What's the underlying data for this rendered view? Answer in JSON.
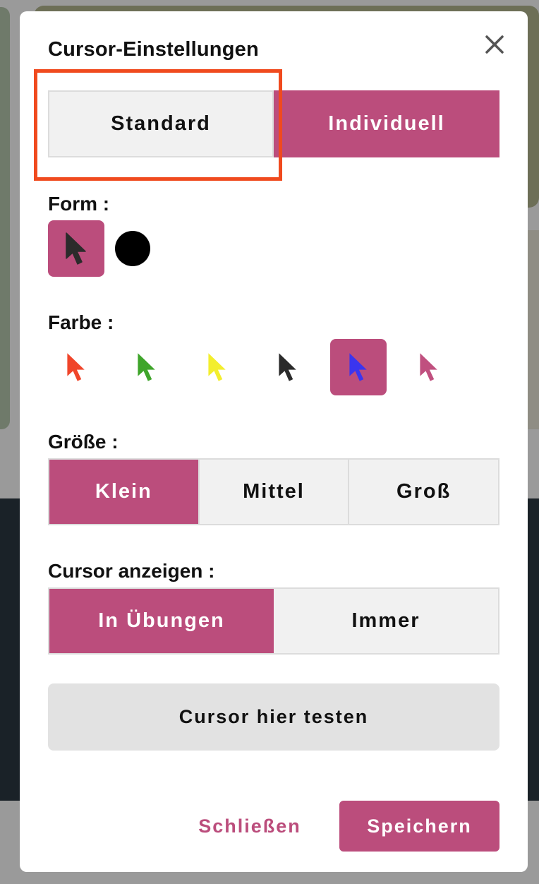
{
  "dialog": {
    "title": "Cursor-Einstellungen",
    "close_icon": "close-icon"
  },
  "mode_toggle": {
    "standard_label": "Standard",
    "custom_label": "Individuell",
    "selected": "Individuell"
  },
  "form": {
    "label": "Form :",
    "options": [
      {
        "icon": "arrow-cursor-icon",
        "selected": true
      },
      {
        "icon": "circle-cursor-icon",
        "selected": false
      }
    ]
  },
  "farbe": {
    "label": "Farbe :",
    "options": [
      {
        "icon": "red-arrow-icon",
        "color": "#f0452a",
        "selected": false
      },
      {
        "icon": "green-arrow-icon",
        "color": "#3fa52b",
        "selected": false
      },
      {
        "icon": "yellow-arrow-icon",
        "color": "#f3ee2e",
        "selected": false
      },
      {
        "icon": "black-arrow-icon",
        "color": "#2b2b2b",
        "selected": false
      },
      {
        "icon": "blue-arrow-icon",
        "color": "#3a35ef",
        "selected": true
      },
      {
        "icon": "pink-arrow-icon",
        "color": "#c0507f",
        "selected": false
      }
    ]
  },
  "groesse": {
    "label": "Größe :",
    "options": [
      "Klein",
      "Mittel",
      "Groß"
    ],
    "selected": "Klein"
  },
  "anzeigen": {
    "label": "Cursor anzeigen :",
    "options": [
      "In Übungen",
      "Immer"
    ],
    "selected": "In Übungen"
  },
  "test": {
    "label": "Cursor hier testen"
  },
  "footer": {
    "close_label": "Schließen",
    "save_label": "Speichern"
  },
  "colors": {
    "accent": "#bb4d7c",
    "highlight": "#f04a1e"
  }
}
